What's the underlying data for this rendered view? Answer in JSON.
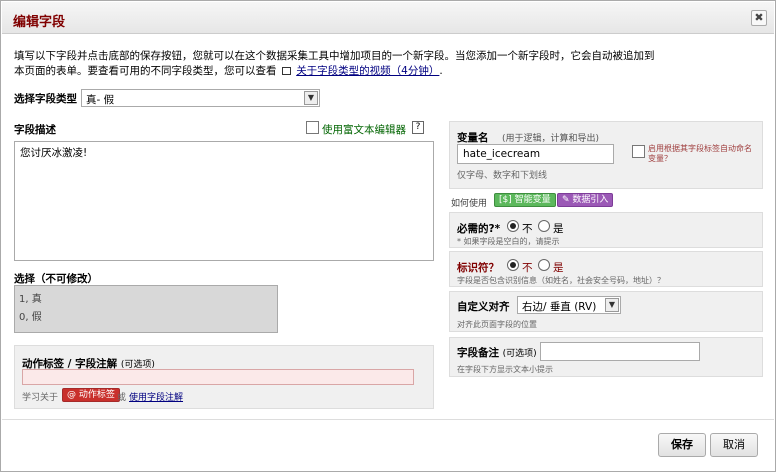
{
  "dialog": {
    "title": "编辑字段",
    "close_glyph": "✖"
  },
  "intro": {
    "line1": "填写以下字段并点击底部的保存按钮，您就可以在这个数据采集工具中增加项目的一个新字段。当您添加一个新字段时，它会自动被追加到",
    "line2_prefix": "本页面的表单。要查看可用的不同字段类型，您可以查看",
    "link": "关于字段类型的视频（4分钟）",
    "line2_suffix": "."
  },
  "field_type": {
    "label": "选择字段类型",
    "value": "真- 假"
  },
  "field_desc": {
    "label": "字段描述",
    "rich_text_label": "使用富文本编辑器",
    "help": "?",
    "value": "您讨厌冰激凌!"
  },
  "choices": {
    "label": "选择（不可修改）",
    "items": [
      "1, 真",
      "0, 假"
    ]
  },
  "action_tags": {
    "label": "动作标签 / 字段注解",
    "optional": "(可选项)",
    "learn_prefix": "学习关于",
    "tag_button": "@ 动作标签",
    "or": "或",
    "link": "使用字段注解",
    "value": ""
  },
  "variable": {
    "label": "变量名",
    "hint": "(用于逻辑，计算和导出)",
    "value": "hate_icecream",
    "sublabel": "仅字母、数字和下划线",
    "auto_label": "启用根据其字段标签自动命名变量？"
  },
  "how_to": {
    "label": "如何使用",
    "smart_vars": "[$] 智能变量",
    "piping": "数据引入"
  },
  "required": {
    "label": "必需的?*",
    "no": "不",
    "yes": "是",
    "note": "* 如果字段是空白的，请提示"
  },
  "identifier": {
    "label": "标识符？",
    "no": "不",
    "yes": "是",
    "note": "字段是否包含识别信息（如姓名，社会安全号码，地址）？"
  },
  "alignment": {
    "label": "自定义对齐",
    "value": "右边/ 垂直 (RV)",
    "note": "对齐此页面字段的位置"
  },
  "field_note": {
    "label": "字段备注",
    "optional": "(可选项)",
    "value": "",
    "note": "在字段下方显示文本小提示"
  },
  "footer": {
    "save": "保存",
    "cancel": "取消"
  },
  "colors": {
    "title": "#800000",
    "required_label": "#000000",
    "identifier_label": "#800000",
    "smart_vars_bg": "#5cb85c",
    "piping_bg": "#9b59b6",
    "action_tag_bg": "#c9302c"
  }
}
